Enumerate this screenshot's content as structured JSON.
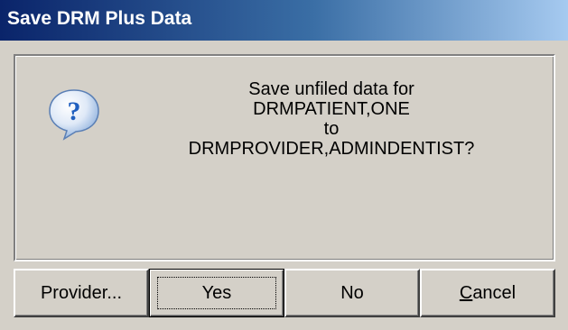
{
  "window": {
    "title": "Save DRM Plus Data"
  },
  "message": {
    "icon": "question-icon",
    "line1": "Save unfiled data for",
    "line2": "DRMPATIENT,ONE",
    "line3": "to",
    "line4": "DRMPROVIDER,ADMINDENTIST?"
  },
  "buttons": {
    "provider_label": "Provider...",
    "yes_label": "Yes",
    "no_label": "No",
    "cancel_accel": "C",
    "cancel_rest": "ancel"
  },
  "colors": {
    "title_gradient_start": "#0a246a",
    "title_gradient_end": "#a6caf0",
    "face": "#d4d0c8",
    "icon_blue": "#1f5fbf"
  }
}
